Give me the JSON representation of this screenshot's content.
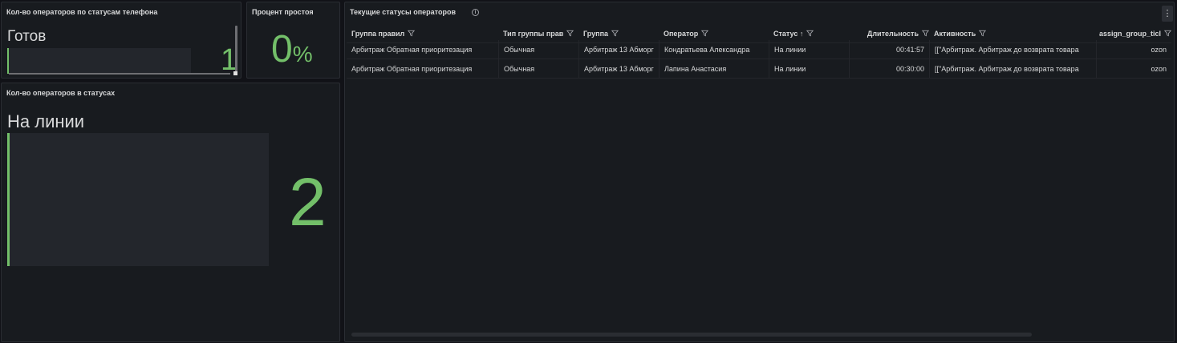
{
  "panels": {
    "phone_status": {
      "title": "Кол-во операторов по статусам телефона",
      "label": "Готов",
      "value": "1",
      "fill_fraction": 0.01,
      "color": "#73bf69"
    },
    "idle_percent": {
      "title": "Процент простоя",
      "value": "0",
      "unit": "%",
      "color": "#73bf69"
    },
    "status_count": {
      "title": "Кол-во операторов в статусах",
      "label": "На линии",
      "value": "2",
      "fill_fraction": 0.01,
      "color": "#73bf69"
    },
    "operators_table": {
      "title": "Текущие статусы операторов",
      "info_icon": "info-icon",
      "menu_icon": "kebab-menu-icon",
      "menu_glyph": "⋮",
      "columns": [
        {
          "label": "Группа правил",
          "filter": true
        },
        {
          "label": "Тип группы прав",
          "filter": true
        },
        {
          "label": "Группа",
          "filter": true
        },
        {
          "label": "Оператор",
          "filter": true
        },
        {
          "label": "Статус",
          "sort": "↑",
          "filter": true
        },
        {
          "label": "Длительность",
          "filter": true
        },
        {
          "label": "Активность",
          "filter": true
        },
        {
          "label": "assign_group_ticl",
          "filter": true
        }
      ],
      "rows": [
        [
          "Арбитраж Обратная приоритезация",
          "Обычная",
          "Арбитраж 13 Абморг",
          "Кондратьева Александра",
          "На линии",
          "00:41:57",
          "[[\"Арбитраж. Арбитраж до возврата товара",
          "ozon"
        ],
        [
          "Арбитраж Обратная приоритезация",
          "Обычная",
          "Арбитраж 13 Абморг",
          "Лапина Анастасия",
          "На линии",
          "00:30:00",
          "[[\"Арбитраж. Арбитраж до возврата товара",
          "ozon"
        ]
      ]
    }
  }
}
